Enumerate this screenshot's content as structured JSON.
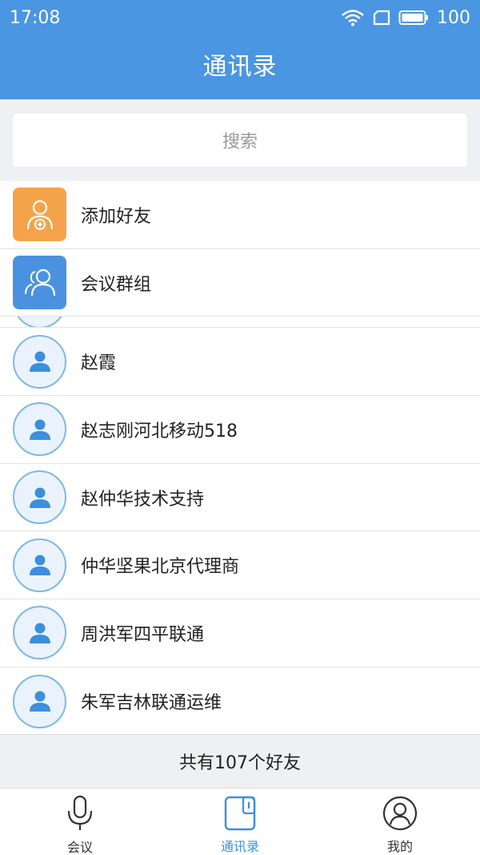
{
  "status_bar": {
    "time": "17:08",
    "battery": "100"
  },
  "header": {
    "title": "通讯录"
  },
  "search": {
    "placeholder": "搜索"
  },
  "special_items": [
    {
      "label": "添加好友",
      "icon": "add-friend-icon",
      "color": "#f5a34a"
    },
    {
      "label": "会议群组",
      "icon": "group-icon",
      "color": "#4a92df"
    }
  ],
  "contacts": [
    {
      "name": "赵霞"
    },
    {
      "name": "赵志刚河北移动518"
    },
    {
      "name": "赵仲华技术支持"
    },
    {
      "name": "仲华坚果北京代理商"
    },
    {
      "name": "周洪军四平联通"
    },
    {
      "name": "朱军吉林联通运维"
    }
  ],
  "summary": {
    "count_text": "共有107个好友"
  },
  "tabs": [
    {
      "label": "会议",
      "icon": "microphone-icon",
      "active": false
    },
    {
      "label": "通讯录",
      "icon": "contacts-book-icon",
      "active": true
    },
    {
      "label": "我的",
      "icon": "profile-icon",
      "active": false
    }
  ],
  "colors": {
    "primary": "#4a96e2",
    "accent_orange": "#f5a34a",
    "tab_active": "#3a8fe0"
  }
}
